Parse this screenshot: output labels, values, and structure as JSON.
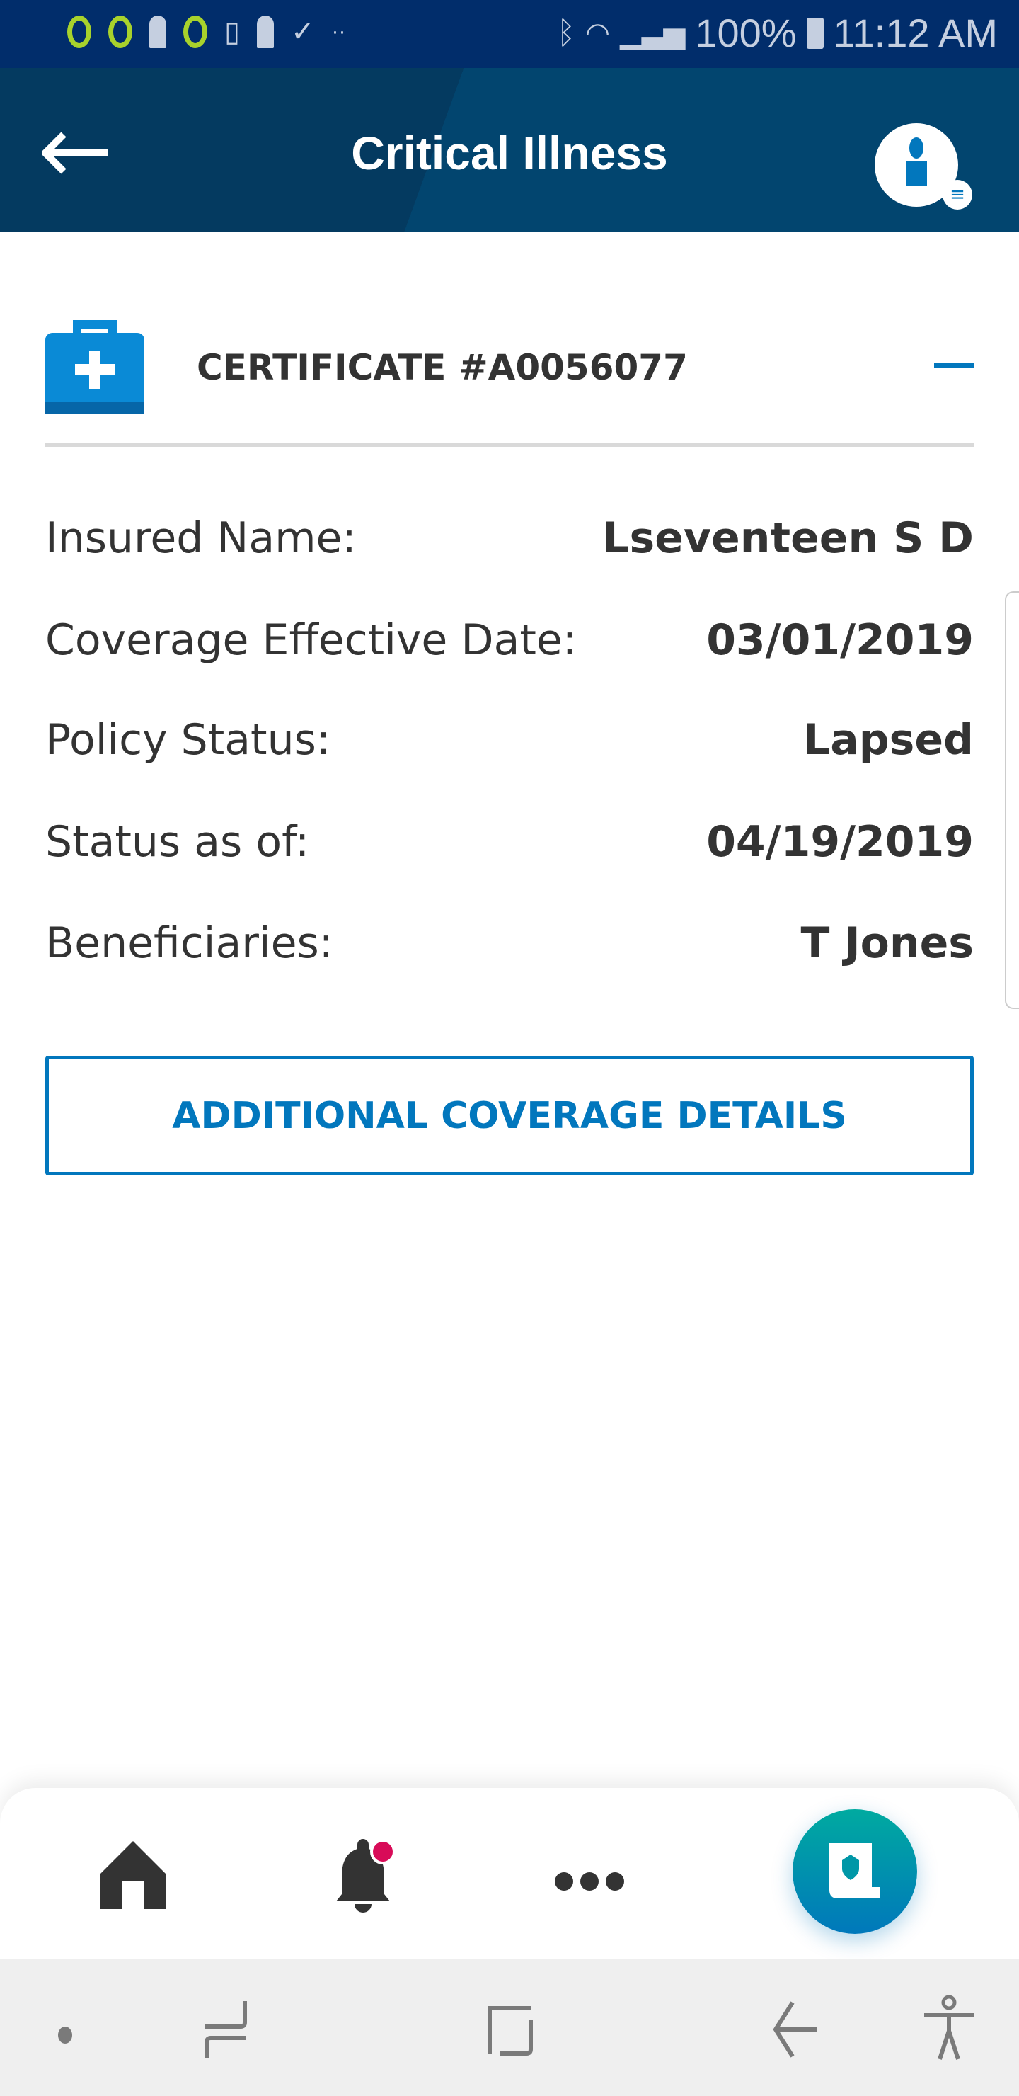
{
  "status_bar": {
    "battery": "100%",
    "time": "11:12 AM"
  },
  "header": {
    "title": "Critical Illness"
  },
  "certificate": {
    "title": "CERTIFICATE #A0056077",
    "rows": [
      {
        "label": "Insured Name:",
        "value": "Lseventeen S D"
      },
      {
        "label": "Coverage Effective Date:",
        "value": "03/01/2019"
      },
      {
        "label": "Policy Status:",
        "value": "Lapsed"
      },
      {
        "label": "Status as of:",
        "value": "04/19/2019"
      },
      {
        "label": "Beneficiaries:",
        "value": "T Jones"
      }
    ],
    "button_label": "ADDITIONAL COVERAGE DETAILS"
  },
  "colors": {
    "accent": "#0277bd",
    "header": "#043a60",
    "notification": "#d80b58"
  }
}
